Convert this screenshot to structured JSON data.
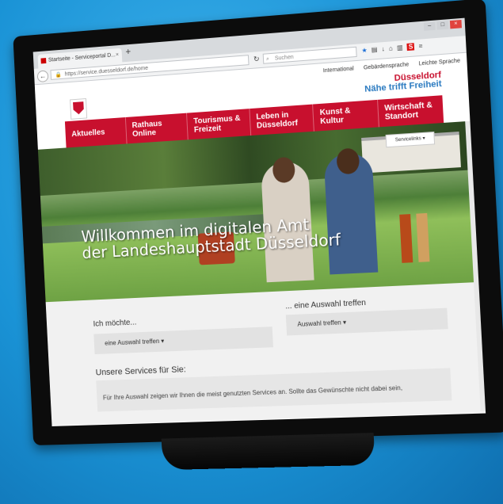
{
  "browser": {
    "tab_title": "Startseite - Serviceportal D...",
    "tab_close": "×",
    "new_tab": "+",
    "url": "https://service.duesseldorf.de/home",
    "search_placeholder": "Suchen",
    "window_buttons": [
      "–",
      "□",
      "×"
    ]
  },
  "site": {
    "top_links": [
      "International",
      "Gebärdensprache",
      "Leichte Sprache"
    ],
    "brand_line1": "Düsseldorf",
    "brand_line2": "Nähe trifft Freiheit",
    "menu": [
      "Aktuelles",
      "Rathaus Online",
      "Tourismus & Freizeit",
      "Leben in Düsseldorf",
      "Kunst & Kultur",
      "Wirtschaft & Standort"
    ],
    "service_button": "Servicelinks ▾",
    "welcome_line1": "Willkommen im digitalen Amt",
    "welcome_line2": "der Landeshauptstadt Düsseldorf",
    "ich_moechte_label": "Ich möchte...",
    "ich_moechte_select": "eine Auswahl treffen ▾",
    "auswahl_label": "... eine Auswahl treffen",
    "auswahl_select": "Auswahl treffen ▾",
    "services_title": "Unsere Services für Sie:",
    "services_text": "Für Ihre Auswahl zeigen wir Ihnen die meist genutzten Services an. Sollte das Gewünschte nicht dabei sein,"
  },
  "colors": {
    "brand_red": "#c8102e",
    "brand_blue": "#2a7ac0",
    "background": "#1a93d6"
  }
}
